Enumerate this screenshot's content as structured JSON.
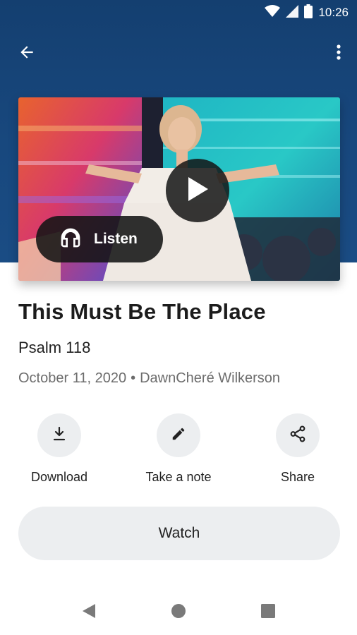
{
  "status_bar": {
    "time": "10:26",
    "icons": [
      "wifi-icon",
      "cell-signal-icon",
      "battery-icon"
    ]
  },
  "app_bar": {
    "back_icon": "arrow-back-icon",
    "menu_icon": "more-vertical-icon"
  },
  "colors": {
    "header_bg": "#18477d",
    "button_bg": "#eceef0",
    "overlay": "#141414",
    "meta_text": "#6c6c6c"
  },
  "video": {
    "play_icon": "play-icon",
    "listen_label": "Listen",
    "listen_icon": "headphones-icon"
  },
  "sermon": {
    "title": "This Must Be The Place",
    "scripture": "Psalm 118",
    "date": "October 11, 2020",
    "separator": "•",
    "speaker": "DawnCheré Wilkerson"
  },
  "actions": [
    {
      "label": "Download",
      "icon": "download-icon"
    },
    {
      "label": "Take a note",
      "icon": "pencil-icon"
    },
    {
      "label": "Share",
      "icon": "share-icon"
    }
  ],
  "watch_label": "Watch",
  "nav_bar": {
    "icons": [
      "nav-back-icon",
      "nav-home-icon",
      "nav-recents-icon"
    ]
  }
}
